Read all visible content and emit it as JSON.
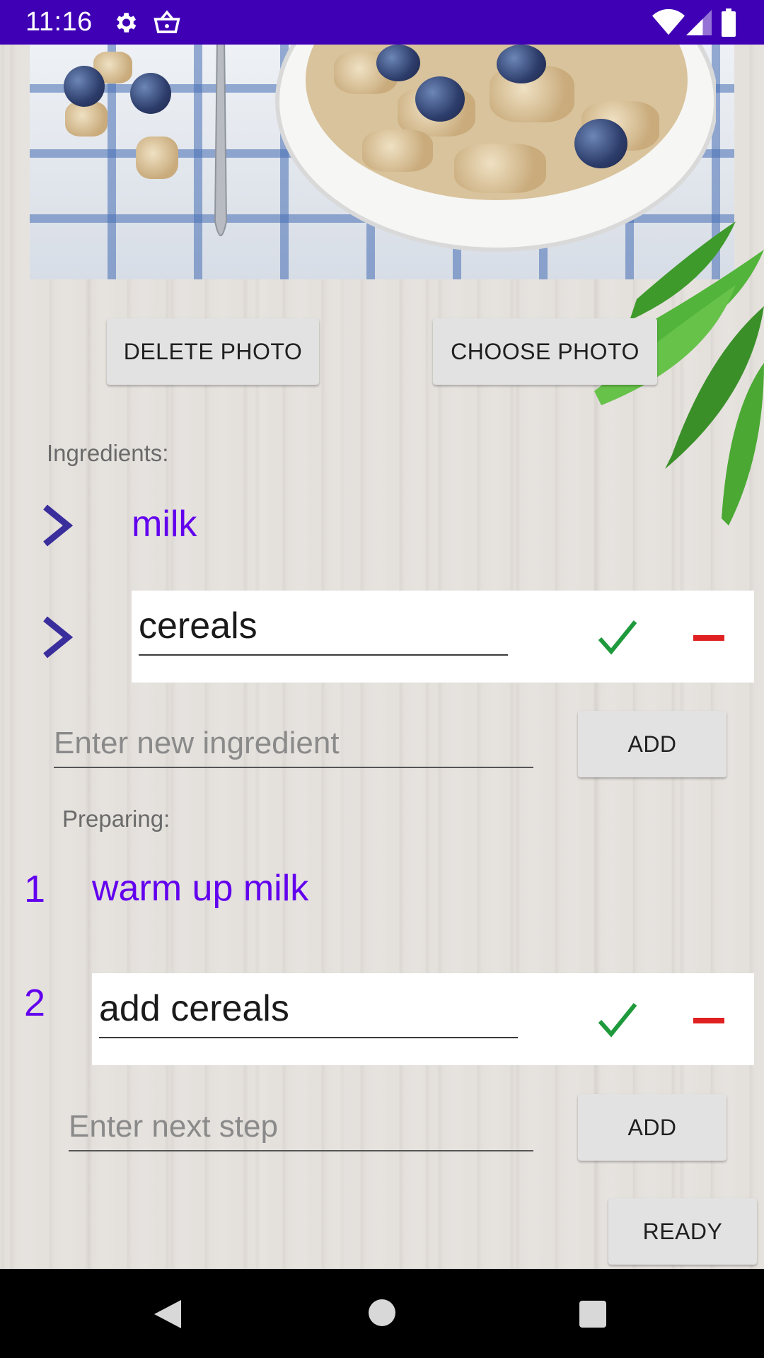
{
  "status_bar": {
    "time": "11:16",
    "icons": [
      "gear-icon",
      "basket-icon",
      "wifi-icon",
      "signal-icon",
      "battery-icon"
    ]
  },
  "photo_actions": {
    "delete_label": "DELETE PHOTO",
    "choose_label": "CHOOSE PHOTO"
  },
  "ingredients": {
    "heading": "Ingredients:",
    "items": [
      {
        "text": "milk",
        "editing": false
      },
      {
        "text": "cereals",
        "editing": true
      }
    ],
    "new_placeholder": "Enter new ingredient",
    "add_label": "ADD"
  },
  "preparing": {
    "heading": "Preparing:",
    "steps": [
      {
        "number": "1",
        "text": "warm up milk",
        "editing": false
      },
      {
        "number": "2",
        "text": "add cereals",
        "editing": true
      }
    ],
    "new_placeholder": "Enter next step",
    "add_label": "ADD"
  },
  "ready_label": "READY",
  "colors": {
    "status_bar": "#3f00b5",
    "accent_purple": "#6200ee",
    "chevron": "#3a2d9c",
    "check_green": "#1e9a3c",
    "minus_red": "#e02020"
  }
}
